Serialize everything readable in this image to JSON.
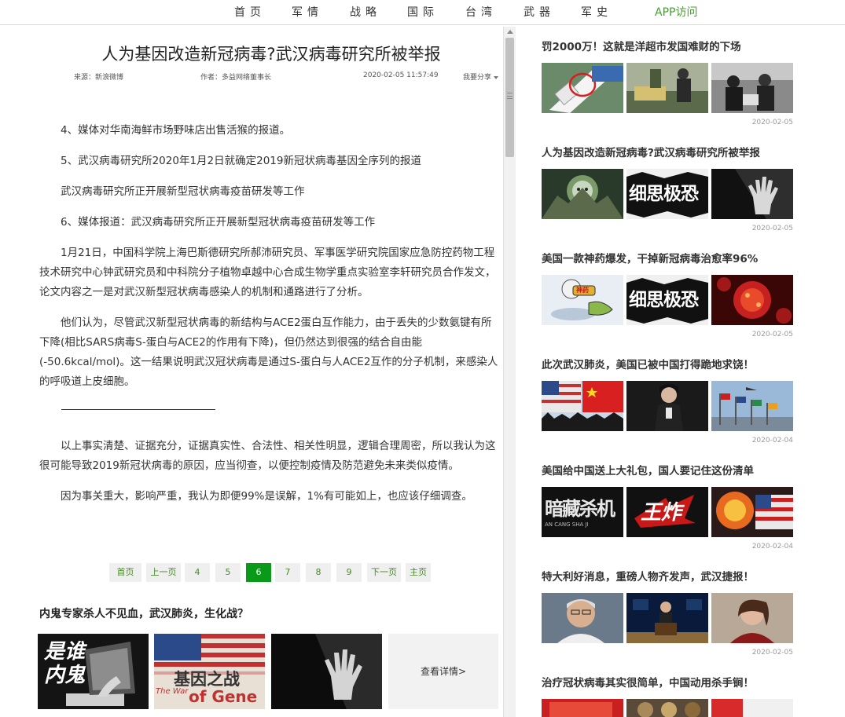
{
  "nav": {
    "items": [
      "首页",
      "军情",
      "战略",
      "国际",
      "台湾",
      "武器",
      "军史"
    ],
    "app": "APP访问"
  },
  "article": {
    "title": "人为基因改造新冠病毒?武汉病毒研究所被举报",
    "source": "来源：新浪微博",
    "author": "作者：多益网络董事长",
    "time": "2020-02-05  11:57:49",
    "share": "我要分享",
    "paragraphs": [
      "4、媒体对华南海鲜市场野味店出售活猴的报道。",
      "5、武汉病毒研究所2020年1月2日就确定2019新冠状病毒基因全序列的报道",
      "武汉病毒研究所正开展新型冠状病毒疫苗研发等工作",
      "6、媒体报道：武汉病毒研究所正开展新型冠状病毒疫苗研发等工作",
      "1月21日，中国科学院上海巴斯德研究所郝沛研究员、军事医学研究院国家应急防控药物工程技术研究中心钟武研究员和中科院分子植物卓越中心合成生物学重点实验室李轩研究员合作发文，论文内容之一是对武汉新型冠状病毒感染人的机制和通路进行了分析。",
      "他们认为，尽管武汉新型冠状病毒的新结构与ACE2蛋白互作能力，由于丢失的少数氨键有所下降(相比SARS病毒S-蛋白与ACE2的作用有下降)，但仍然达到很强的结合自由能(-50.6kcal/mol)。这一结果说明武汉冠状病毒是通过S-蛋白与人ACE2互作的分子机制，来感染人的呼吸道上皮细胞。"
    ],
    "paragraphs_after": [
      "以上事实清楚、证据充分，证据真实性、合法性、相关性明显，逻辑合理周密，所以我认为这很可能导致2019新冠状病毒的原因，应当彻查，以便控制疫情及防范避免未来类似疫情。",
      "因为事关重大，影响严重，我认为即便99%是误解，1%有可能如上，也应该仔细调查。"
    ]
  },
  "pager": {
    "items": [
      "首页",
      "上一页",
      "4",
      "5",
      "6",
      "7",
      "8",
      "9",
      "下一页",
      "主页"
    ],
    "current": "6"
  },
  "related": {
    "title": "内鬼专家杀人不见血，武汉肺炎，生化战？",
    "img1_text": "是谁内鬼",
    "img2_text1": "基因之战",
    "img2_text2": "The War",
    "img2_text3": "of Gene",
    "more": "查看详情>"
  },
  "sidebar": {
    "news": [
      {
        "title": "罚2000万！这就是洋超市发国难财的下场",
        "date": "2020-02-05"
      },
      {
        "title": "人为基因改造新冠病毒?武汉病毒研究所被举报",
        "date": "2020-02-05",
        "img_text": "细思极恐"
      },
      {
        "title": "美国一款神药爆发，干掉新冠病毒治愈率96%",
        "date": "2020-02-05",
        "img_text": "细思极恐",
        "img_text_2": "神药"
      },
      {
        "title": "此次武汉肺炎，美国已被中国打得跪地求饶！",
        "date": "2020-02-04"
      },
      {
        "title": "美国给中国送上大礼包，国人要记住这份清单",
        "date": "2020-02-04",
        "img_text": "暗藏杀机",
        "img_text_2": "AN CANG SHA JI",
        "img_text_3": "王炸"
      },
      {
        "title": "特大利好消息，重磅人物齐发声，武汉捷报！",
        "date": "2020-02-05"
      },
      {
        "title": "治疗冠状病毒其实很简单，中国动用杀手锏！",
        "date": ""
      }
    ]
  },
  "colors": {
    "accent": "#0a9a1a",
    "link_green": "#4a9a3a"
  }
}
